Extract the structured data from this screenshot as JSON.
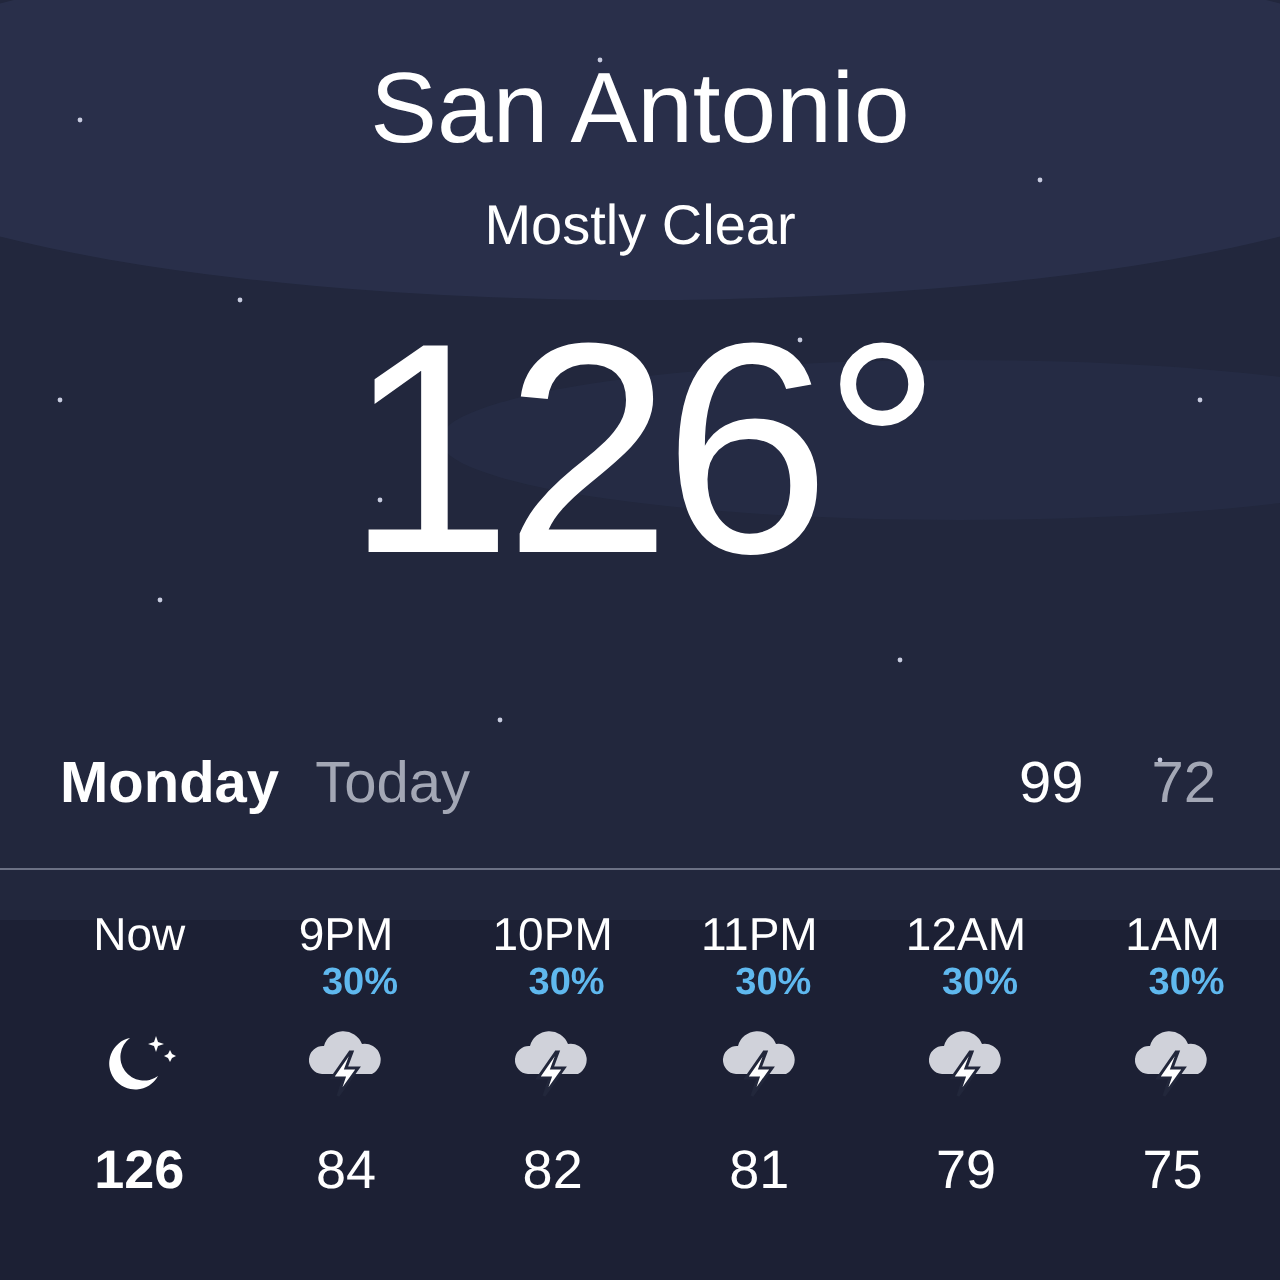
{
  "location": {
    "city": "San Antonio",
    "condition": "Mostly Clear",
    "temperature": "126°"
  },
  "day": {
    "name": "Monday",
    "label": "Today",
    "high": "99",
    "low": "72"
  },
  "hourly": [
    {
      "time": "Now",
      "kind": "moon",
      "temp": "126",
      "current": true
    },
    {
      "time": "9PM",
      "chance": "30%",
      "kind": "storm",
      "temp": "84",
      "current": false
    },
    {
      "time": "10PM",
      "chance": "30%",
      "kind": "storm",
      "temp": "82",
      "current": false
    },
    {
      "time": "11PM",
      "chance": "30%",
      "kind": "storm",
      "temp": "81",
      "current": false
    },
    {
      "time": "12AM",
      "chance": "30%",
      "kind": "storm",
      "temp": "79",
      "current": false
    },
    {
      "time": "1AM",
      "chance": "30%",
      "kind": "storm",
      "temp": "75",
      "current": false
    }
  ]
}
